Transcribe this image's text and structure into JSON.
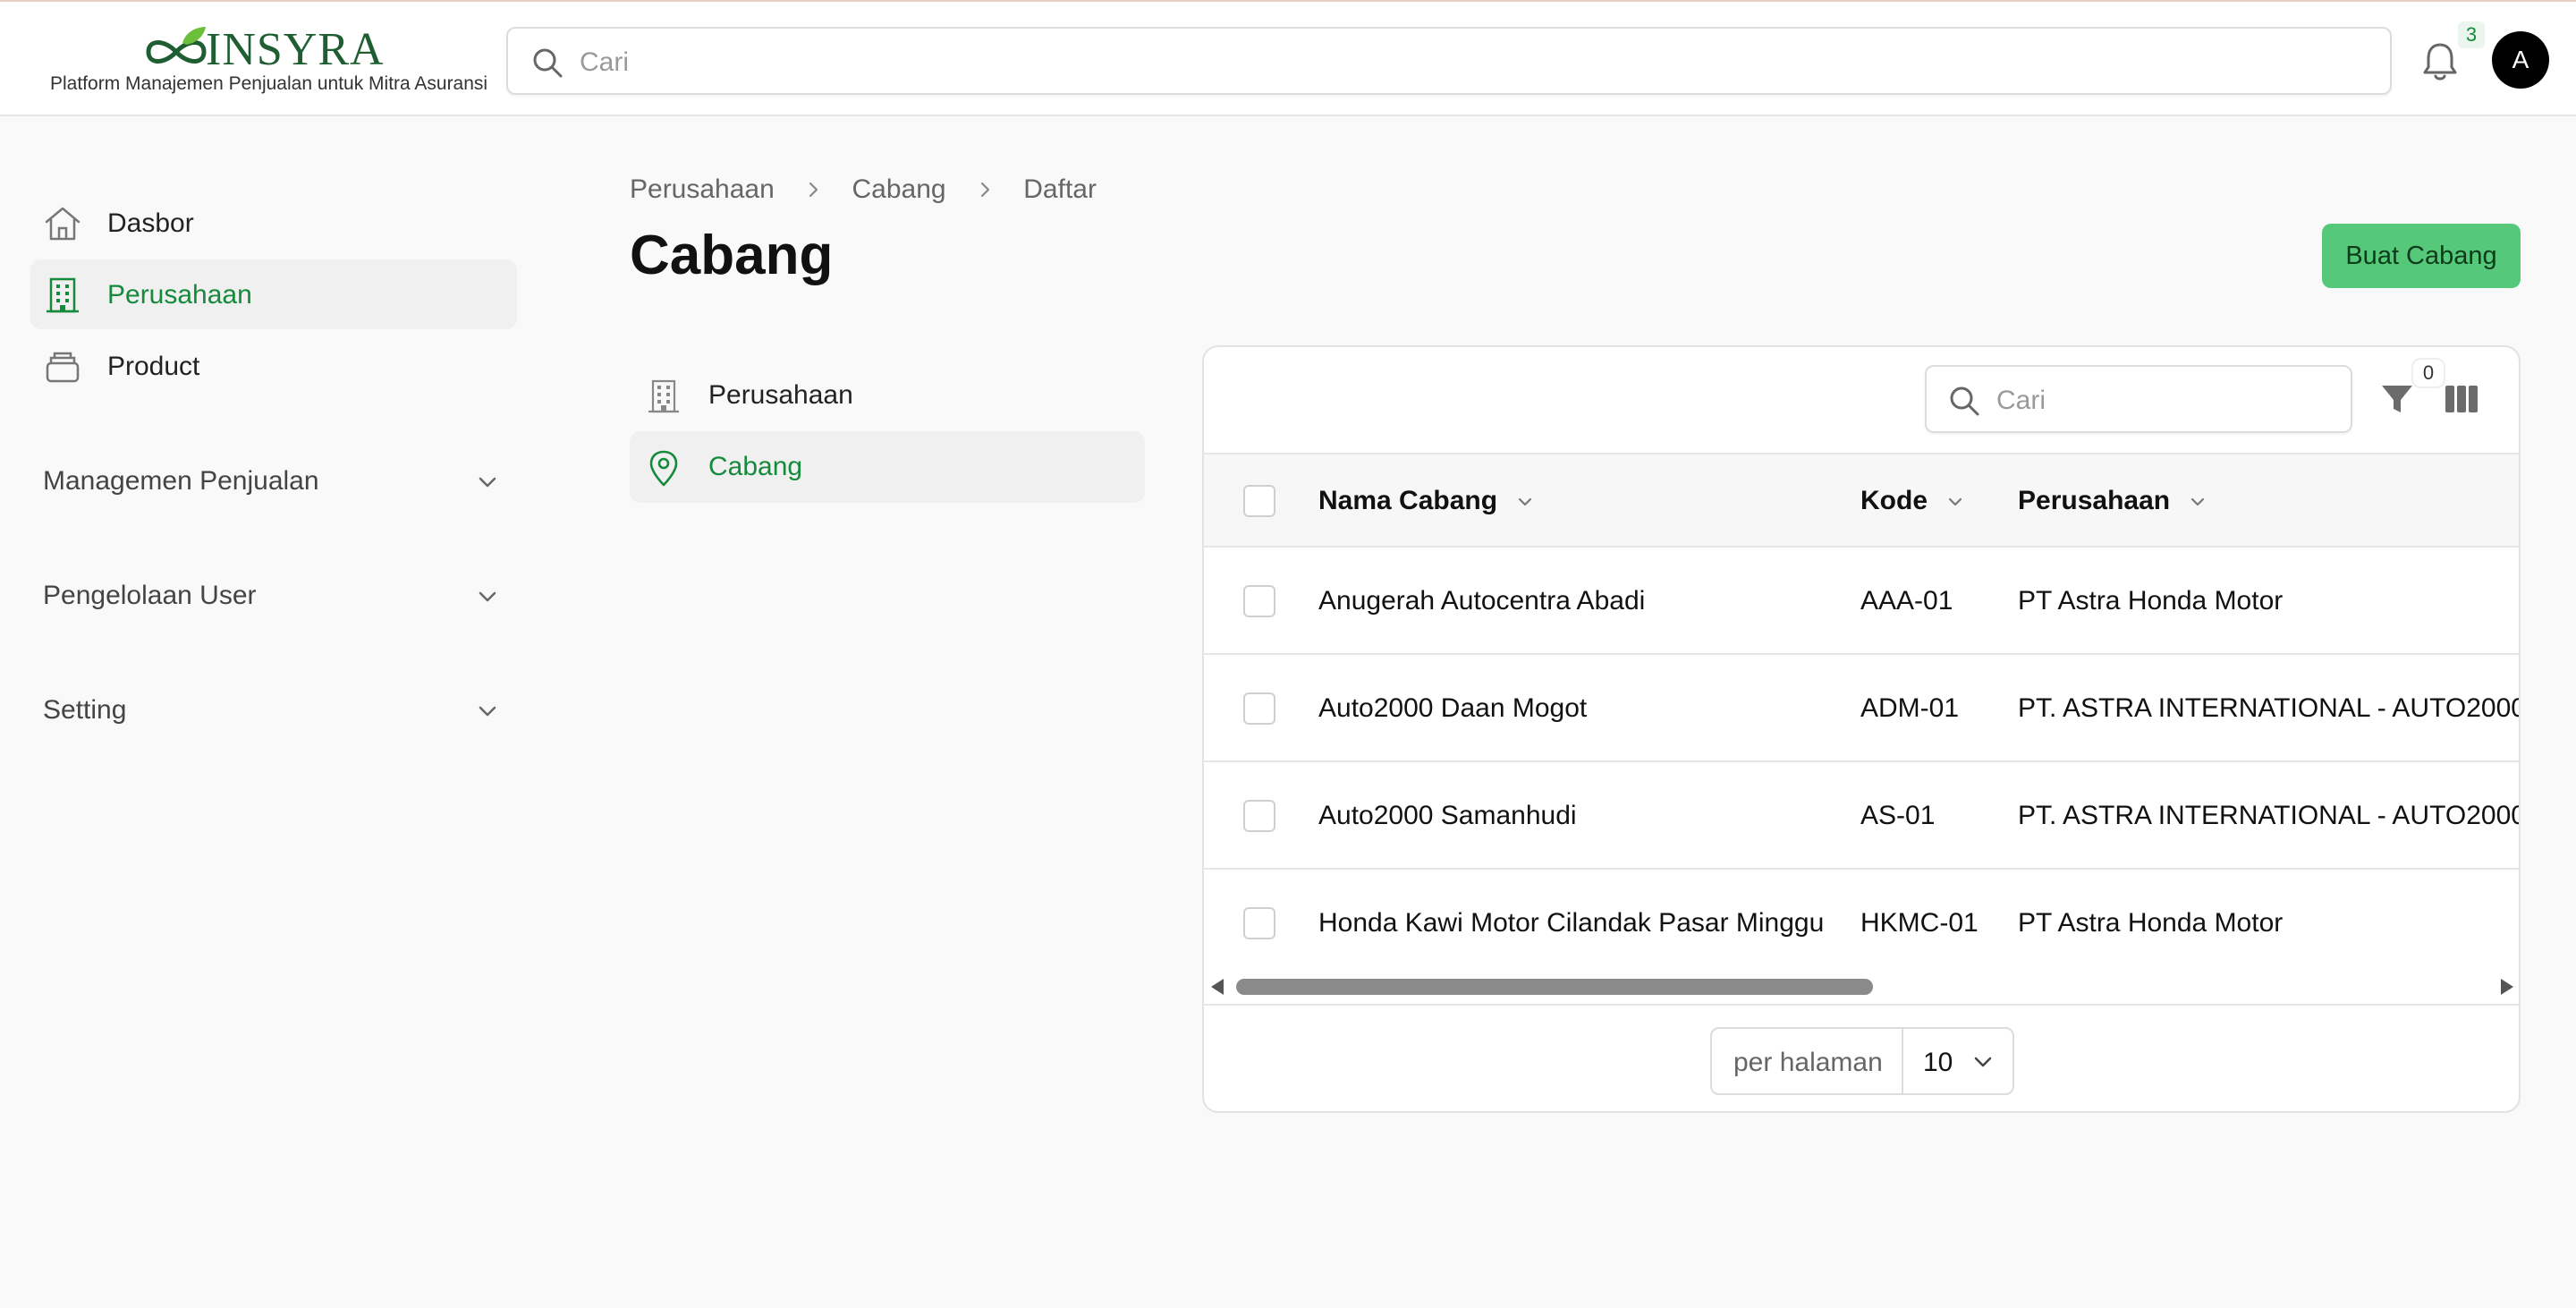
{
  "app": {
    "brand": "INSYRA",
    "tagline": "Platform Manajemen Penjualan untuk Mitra Asuransi",
    "search_placeholder": "Cari",
    "notification_count": "3",
    "avatar_initial": "A",
    "accent_color": "#158a3c",
    "primary_button_color": "#56c879"
  },
  "sidebar": {
    "items": [
      {
        "label": "Dasbor",
        "icon": "home-icon",
        "active": false
      },
      {
        "label": "Perusahaan",
        "icon": "building-icon",
        "active": true
      },
      {
        "label": "Product",
        "icon": "archive-icon",
        "active": false
      }
    ],
    "groups": [
      {
        "label": "Managemen Penjualan"
      },
      {
        "label": "Pengelolaan User"
      },
      {
        "label": "Setting"
      }
    ]
  },
  "breadcrumb": [
    "Perusahaan",
    "Cabang",
    "Daftar"
  ],
  "page": {
    "title": "Cabang",
    "create_button": "Buat Cabang"
  },
  "subnav": {
    "items": [
      {
        "label": "Perusahaan",
        "icon": "building-icon",
        "active": false
      },
      {
        "label": "Cabang",
        "icon": "map-pin-icon",
        "active": true
      }
    ]
  },
  "table": {
    "search_placeholder": "Cari",
    "filter_count": "0",
    "columns": [
      "Nama Cabang",
      "Kode",
      "Perusahaan"
    ],
    "rows": [
      [
        "Anugerah Autocentra Abadi",
        "AAA-01",
        "PT Astra Honda Motor"
      ],
      [
        "Auto2000 Daan Mogot",
        "ADM-01",
        "PT. ASTRA INTERNATIONAL - AUTO2000"
      ],
      [
        "Auto2000 Samanhudi",
        "AS-01",
        "PT. ASTRA INTERNATIONAL - AUTO2000"
      ],
      [
        "Honda Kawi Motor Cilandak Pasar Minggu",
        "HKMC-01",
        "PT Astra Honda Motor"
      ]
    ],
    "pagination": {
      "per_page_label": "per halaman",
      "per_page_value": "10"
    }
  }
}
